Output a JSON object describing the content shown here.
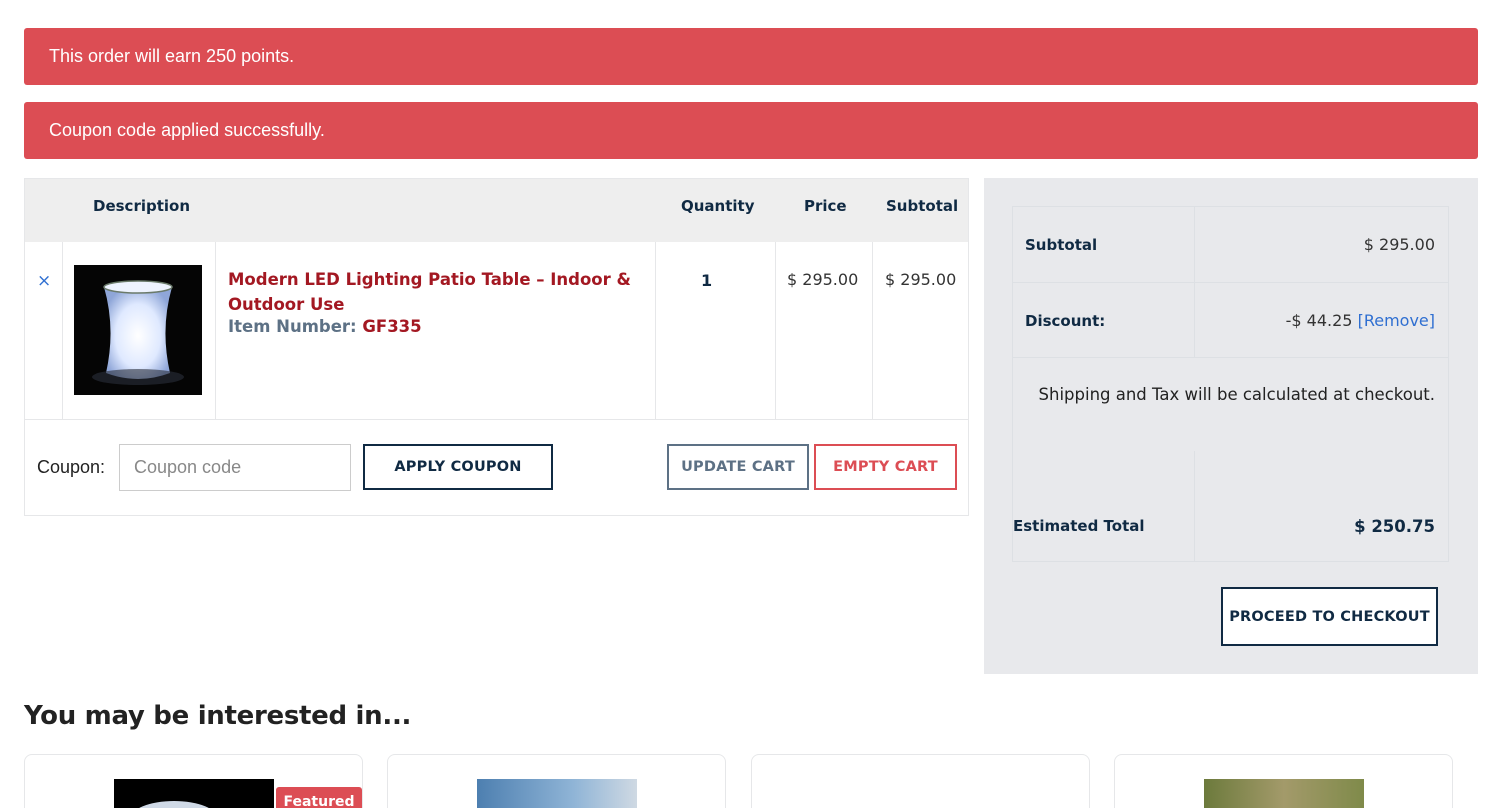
{
  "notices": {
    "points": "This order will earn 250 points.",
    "coupon": "Coupon code applied successfully."
  },
  "cart": {
    "headers": {
      "description": "Description",
      "quantity": "Quantity",
      "price": "Price",
      "subtotal": "Subtotal"
    },
    "item": {
      "remove_icon": "×",
      "name": "Modern LED Lighting Patio Table – Indoor & Outdoor Use",
      "item_number_label": "Item Number:",
      "item_number": "GF335",
      "quantity": "1",
      "price": "$ 295.00",
      "subtotal": "$ 295.00"
    },
    "coupon": {
      "label": "Coupon:",
      "placeholder": "Coupon code",
      "value": "",
      "apply_label": "APPLY COUPON"
    },
    "update_label": "UPDATE CART",
    "empty_label": "EMPTY CART"
  },
  "totals": {
    "subtotal_label": "Subtotal",
    "subtotal_value": "$ 295.00",
    "discount_label": "Discount:",
    "discount_value": "-$ 44.25",
    "discount_remove": "[Remove]",
    "shipping_note": "Shipping and Tax will be calculated at checkout.",
    "estimated_label": "Estimated Total",
    "estimated_value": "$ 250.75",
    "checkout_label": "PROCEED TO CHECKOUT"
  },
  "interest": {
    "title": "You may be interested in...",
    "featured_badge": "Featured"
  },
  "colors": {
    "notice_bg": "#dc4d54",
    "navy": "#102a43",
    "product_red": "#a31822",
    "link_blue": "#2f6fd1"
  }
}
